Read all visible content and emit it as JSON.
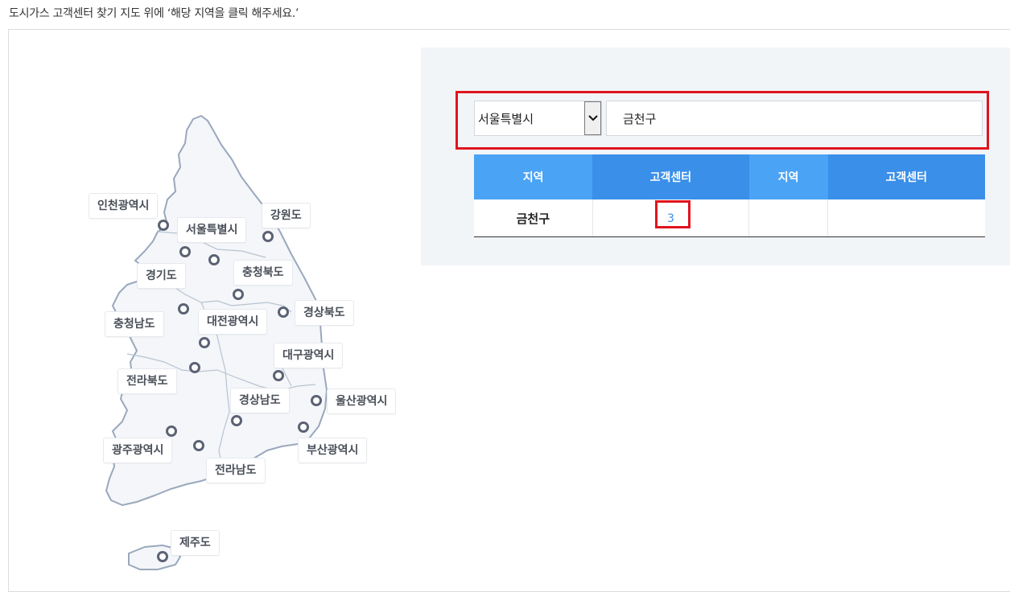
{
  "intro_text": "도시가스 고객센터 찾기 지도 위에 ‘해당 지역을 클릭 해주세요.’",
  "map": {
    "regions": [
      {
        "id": "incheon",
        "label": "인천광역시"
      },
      {
        "id": "seoul",
        "label": "서울특별시"
      },
      {
        "id": "gangwon",
        "label": "강원도"
      },
      {
        "id": "gyeonggi",
        "label": "경기도"
      },
      {
        "id": "chungbuk",
        "label": "충청북도"
      },
      {
        "id": "chungnam",
        "label": "충청남도"
      },
      {
        "id": "daejeon",
        "label": "대전광역시"
      },
      {
        "id": "gyeongbuk",
        "label": "경상북도"
      },
      {
        "id": "daegu",
        "label": "대구광역시"
      },
      {
        "id": "jeonbuk",
        "label": "전라북도"
      },
      {
        "id": "gyeongnam",
        "label": "경상남도"
      },
      {
        "id": "ulsan",
        "label": "울산광역시"
      },
      {
        "id": "gwangju",
        "label": "광주광역시"
      },
      {
        "id": "busan",
        "label": "부산광역시"
      },
      {
        "id": "jeonnam",
        "label": "전라남도"
      },
      {
        "id": "jeju",
        "label": "제주도"
      }
    ]
  },
  "search": {
    "city_value": "서울특별시",
    "district_value": "금천구"
  },
  "table": {
    "headers": [
      "지역",
      "고객센터",
      "지역",
      "고객센터"
    ],
    "rows": [
      {
        "region": "금천구",
        "count": "3",
        "region2": "",
        "count2": ""
      }
    ]
  },
  "colors": {
    "header_light": "#4aa3f5",
    "header_dark": "#3a8fe8",
    "highlight": "#e0141e",
    "panel_bg": "#f2f5f8"
  }
}
